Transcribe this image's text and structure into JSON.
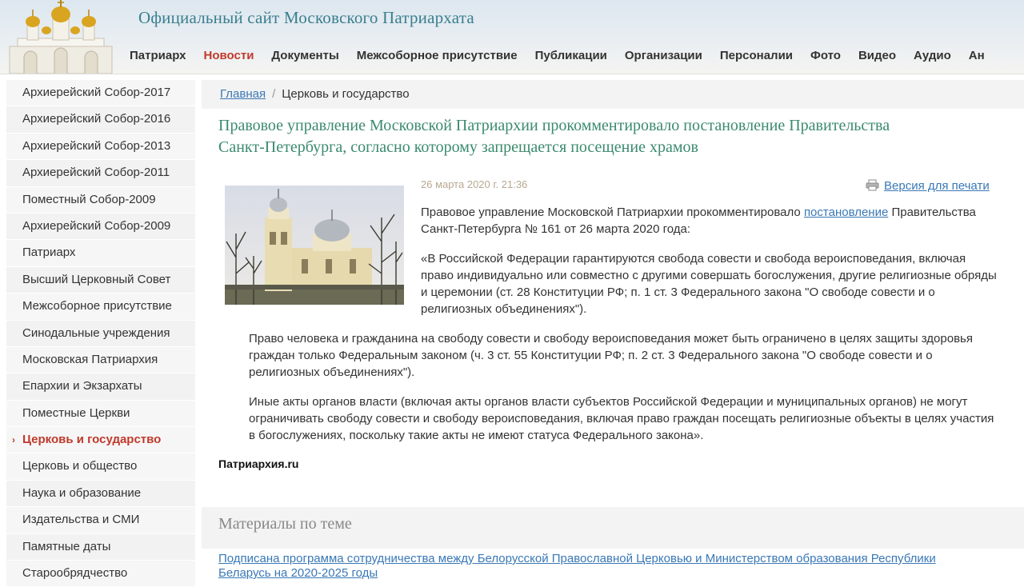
{
  "header": {
    "site_title": "Официальный сайт Московского Патриархата",
    "nav": [
      {
        "label": "Патриарх",
        "active": false
      },
      {
        "label": "Новости",
        "active": true
      },
      {
        "label": "Документы",
        "active": false
      },
      {
        "label": "Межсоборное присутствие",
        "active": false
      },
      {
        "label": "Публикации",
        "active": false
      },
      {
        "label": "Организации",
        "active": false
      },
      {
        "label": "Персоналии",
        "active": false
      },
      {
        "label": "Фото",
        "active": false
      },
      {
        "label": "Видео",
        "active": false
      },
      {
        "label": "Аудио",
        "active": false
      },
      {
        "label": "Ан",
        "active": false
      }
    ]
  },
  "sidebar": {
    "items": [
      {
        "label": "Архиерейский Собор-2017"
      },
      {
        "label": "Архиерейский Собор-2016"
      },
      {
        "label": "Архиерейский Собор-2013"
      },
      {
        "label": "Архиерейский Собор-2011"
      },
      {
        "label": "Поместный Собор-2009"
      },
      {
        "label": "Архиерейский Собор-2009"
      },
      {
        "label": "Патриарх"
      },
      {
        "label": "Высший Церковный Совет"
      },
      {
        "label": "Межсоборное присутствие"
      },
      {
        "label": "Синодальные учреждения"
      },
      {
        "label": "Московская Патриархия"
      },
      {
        "label": "Епархии и Экзархаты"
      },
      {
        "label": "Поместные Церкви"
      },
      {
        "label": "Церковь и государство",
        "active": true
      },
      {
        "label": "Церковь и общество"
      },
      {
        "label": "Наука и образование"
      },
      {
        "label": "Издательства и СМИ"
      },
      {
        "label": "Памятные даты"
      },
      {
        "label": "Старообрядчество"
      }
    ]
  },
  "breadcrumb": {
    "home": "Главная",
    "separator": "/",
    "current": "Церковь и государство"
  },
  "article": {
    "title": "Правовое управление Московской Патриархии прокомментировало постановление Правительства Санкт-Петербурга, согласно которому запрещается посещение храмов",
    "date": "26 марта 2020 г. 21:36",
    "print_label": "Версия для печати",
    "p1_before": "Правовое управление Московской Патриархии прокомментировало ",
    "p1_link": "постановление",
    "p1_after": " Правительства Санкт-Петербурга № 161 от 26 марта 2020 года:",
    "p2": "«В Российской Федерации гарантируются свобода совести и свобода вероисповедания, включая право индивидуально или совместно с другими совершать богослужения, другие религиозные обряды и церемонии (ст. 28 Конституции РФ; п. 1 ст. 3 Федерального закона \"О свободе совести и о религиозных объединениях\").",
    "p3": "Право человека и гражданина на свободу совести и свободу вероисповедания может быть ограничено в целях защиты здоровья граждан только Федеральным законом (ч. 3 ст. 55 Конституции РФ; п. 2 ст. 3 Федерального закона \"О свободе совести и о религиозных объединениях\").",
    "p4": "Иные акты органов власти (включая акты органов власти субъектов Российской Федерации и муниципальных органов) не могут ограничивать свободу совести и свободу вероисповедания, включая право граждан посещать религиозные объекты в целях участия в богослужениях, поскольку такие акты не имеют статуса Федерального закона».",
    "source": "Патриархия.ru"
  },
  "related": {
    "title": "Материалы по теме",
    "items": [
      {
        "label": "Подписана программа сотрудничества между Белорусской Православной Церковью и Министерством образования Республики Беларусь на 2020-2025 годы"
      }
    ]
  },
  "colors": {
    "accent_red": "#c0392b",
    "title_green": "#3b8a6e",
    "link_blue": "#3a78b6",
    "header_teal": "#3a7f8e"
  },
  "icons": {
    "logo": "cathedral-logo-icon",
    "print": "printer-icon",
    "active_marker": "chevron-right-icon"
  }
}
